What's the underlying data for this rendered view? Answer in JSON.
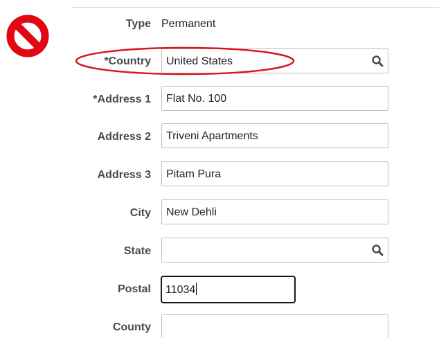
{
  "colors": {
    "prohibit_red": "#e30613",
    "annotation_red": "#d9141c",
    "label_gray": "#4a4a4a"
  },
  "icons": {
    "prohibit": "no-entry-icon",
    "lookup": "magnifier-icon"
  },
  "form": {
    "type": {
      "label": "Type",
      "value": "Permanent"
    },
    "country": {
      "label": "*Country",
      "value": "United States"
    },
    "address1": {
      "label": "*Address 1",
      "value": "Flat No. 100"
    },
    "address2": {
      "label": "Address 2",
      "value": "Triveni Apartments"
    },
    "address3": {
      "label": "Address 3",
      "value": "Pitam Pura"
    },
    "city": {
      "label": "City",
      "value": "New Dehli"
    },
    "state": {
      "label": "State",
      "value": ""
    },
    "postal": {
      "label": "Postal",
      "value": "11034"
    },
    "county": {
      "label": "County",
      "value": ""
    }
  }
}
